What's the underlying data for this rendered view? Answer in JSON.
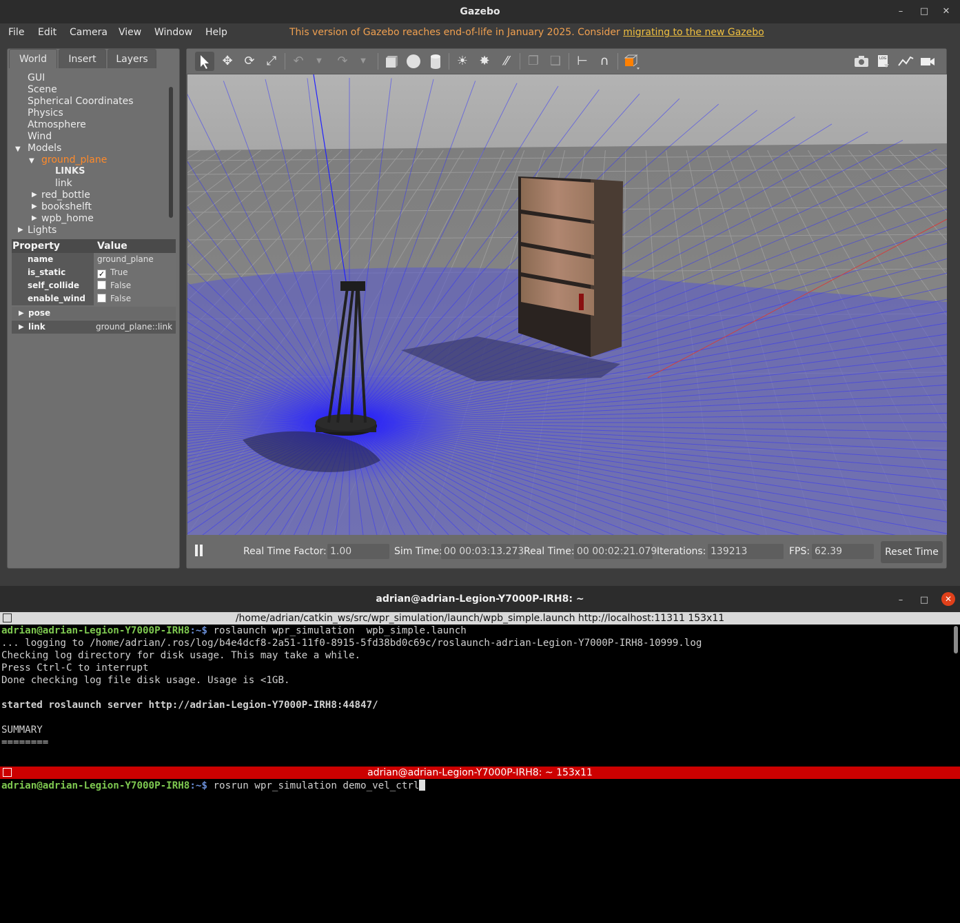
{
  "gazebo": {
    "window_title": "Gazebo",
    "menu": [
      "File",
      "Edit",
      "Camera",
      "View",
      "Window",
      "Help"
    ],
    "eol_notice": "This version of Gazebo reaches end-of-life in January 2025. Consider ",
    "eol_link": "migrating to the new Gazebo",
    "tabs": [
      "World",
      "Insert",
      "Layers"
    ],
    "tree": {
      "gui": "GUI",
      "scene": "Scene",
      "spherical": "Spherical Coordinates",
      "physics": "Physics",
      "atmosphere": "Atmosphere",
      "wind": "Wind",
      "models": "Models",
      "ground_plane": "ground_plane",
      "links_header": "LINKS",
      "link": "link",
      "red_bottle": "red_bottle",
      "bookshelft": "bookshelft",
      "wpb_home": "wpb_home",
      "lights": "Lights"
    },
    "properties": {
      "header_property": "Property",
      "header_value": "Value",
      "name_key": "name",
      "name_val": "ground_plane",
      "is_static_key": "is_static",
      "is_static_val": "True",
      "self_collide_key": "self_collide",
      "self_collide_val": "False",
      "enable_wind_key": "enable_wind",
      "enable_wind_val": "False",
      "pose_key": "pose",
      "link_key": "link",
      "link_val": "ground_plane::link"
    },
    "bottom": {
      "rtf_label": "Real Time Factor:",
      "rtf_value": "1.00",
      "sim_label": "Sim Time:",
      "sim_value": "00 00:03:13.273",
      "real_label": "Real Time:",
      "real_value": "00 00:02:21.079",
      "iter_label": "Iterations:",
      "iter_value": "139213",
      "fps_label": "FPS:",
      "fps_value": "62.39",
      "reset_label": "Reset Time"
    }
  },
  "terminal": {
    "window_title": "adrian@adrian-Legion-Y7000P-IRH8: ~",
    "pane1_title": "/home/adrian/catkin_ws/src/wpr_simulation/launch/wpb_simple.launch http://localhost:11311 153x11",
    "prompt_user": "adrian@adrian-Legion-Y7000P-IRH8",
    "prompt_sep": ":~$ ",
    "pane1_cmd": "roslaunch wpr_simulation  wpb_simple.launch",
    "line2": "... logging to /home/adrian/.ros/log/b4e4dcf8-2a51-11f0-8915-5fd38bd0c69c/roslaunch-adrian-Legion-Y7000P-IRH8-10999.log",
    "line3": "Checking log directory for disk usage. This may take a while.",
    "line4": "Press Ctrl-C to interrupt",
    "line5": "Done checking log file disk usage. Usage is <1GB.",
    "line6": "started roslaunch server http://adrian-Legion-Y7000P-IRH8:44847/",
    "line7": "SUMMARY",
    "line8": "========",
    "pane2_title": "adrian@adrian-Legion-Y7000P-IRH8: ~ 153x11",
    "pane2_cmd": "rosrun wpr_simulation demo_vel_ctrl"
  }
}
